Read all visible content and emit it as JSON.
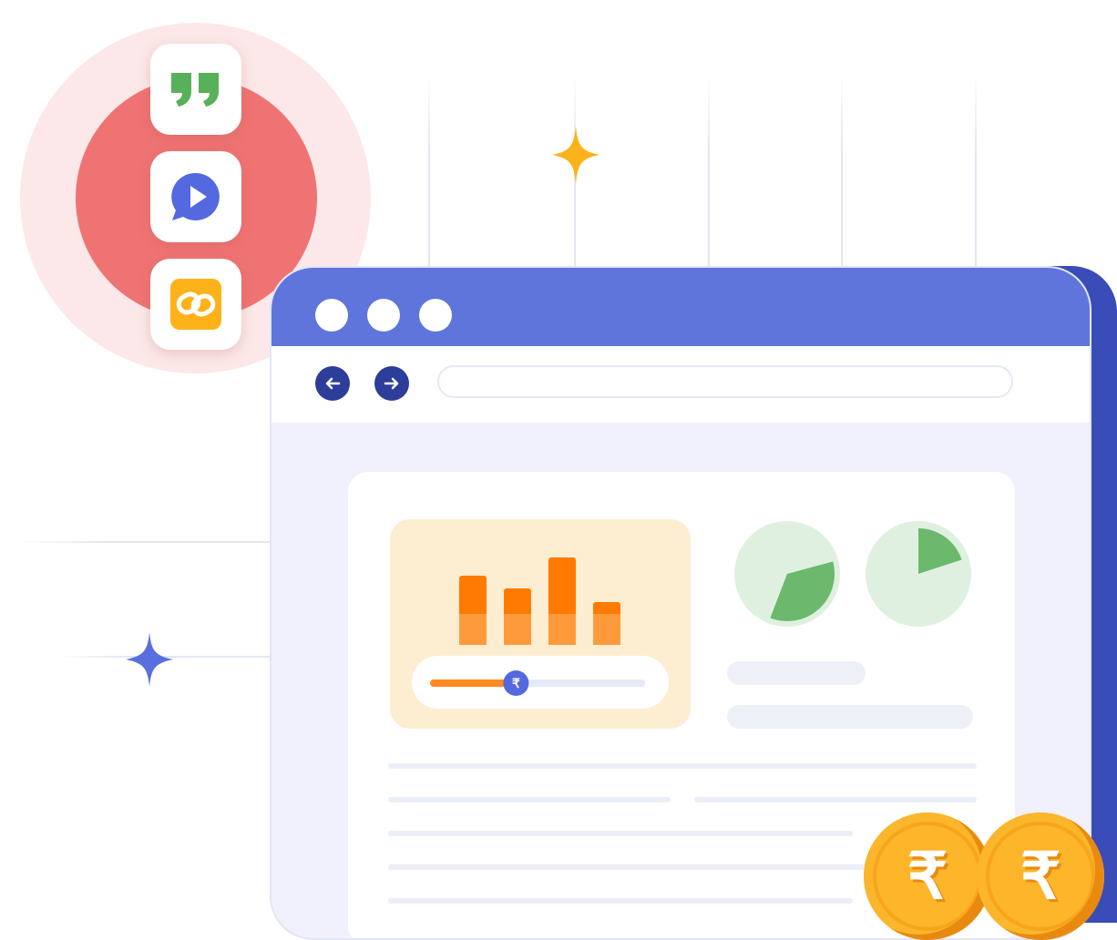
{
  "colors": {
    "titlebar": "#5f75dc",
    "window_side": "#3a4cb7",
    "halo_inner": "#f07373",
    "halo_outer": "#fce8e8",
    "sparkle_gold": "#fdb21a",
    "sparkle_blue": "#5b6ee0",
    "bar_orange": "#ff7a00",
    "pie_green": "#6cb96e",
    "coin_gold": "#f7a51c"
  },
  "icons": {
    "quote": "quote-icon",
    "chat_play": "chat-play-icon",
    "link": "link-icon",
    "back": "arrow-left-icon",
    "forward": "arrow-right-icon",
    "currency": "rupee-icon"
  },
  "browser": {
    "window_dots": 3,
    "url_value": ""
  },
  "slider": {
    "symbol": "₹",
    "level_percent": 40
  },
  "coins": [
    {
      "symbol": "₹"
    },
    {
      "symbol": "₹"
    }
  ],
  "chart_data": {
    "type": "bar",
    "categories": [
      "",
      "",
      "",
      ""
    ],
    "values": [
      76,
      62,
      96,
      47
    ],
    "ylim": [
      0,
      100
    ]
  },
  "pies": [
    {
      "fraction": 0.35
    },
    {
      "fraction": 0.2
    }
  ]
}
